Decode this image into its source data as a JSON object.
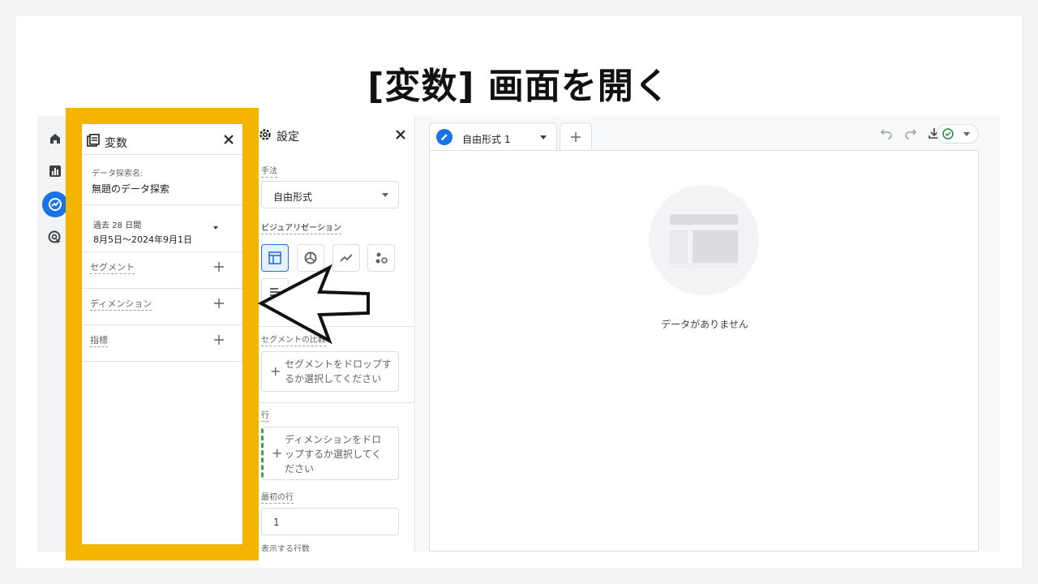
{
  "slide": {
    "title": "[変数] 画面を開く"
  },
  "rail": {
    "items": [
      "home-icon",
      "reports-icon",
      "explore-icon",
      "advertising-icon"
    ],
    "active": "explore-icon"
  },
  "variables": {
    "title": "変数",
    "exploration_name_label": "データ探索名:",
    "exploration_name": "無題のデータ探索",
    "date_range_title": "過去 28 日間",
    "date_range": "8月5日～2024年9月1日",
    "sections": [
      "セグメント",
      "ディメンション",
      "指標"
    ]
  },
  "settings": {
    "title": "設定",
    "technique_label": "手法",
    "technique_value": "自由形式",
    "visualization_label": "ビジュアリゼーション",
    "segment_compare_label": "セグメントの比較",
    "segment_drop_text": "セグメントをドロップするか選択してください",
    "rows_label": "行",
    "rows_drop_text": "ディメンションをドロップするか選択してください",
    "first_row_label": "最初の行",
    "first_row_value": "1",
    "rows_shown_label": "表示する行数"
  },
  "canvas": {
    "tab_label": "自由形式 1",
    "empty_text": "データがありません"
  },
  "colors": {
    "accent": "#1a73e8",
    "highlight": "#f4b400",
    "green": "#34a853"
  }
}
